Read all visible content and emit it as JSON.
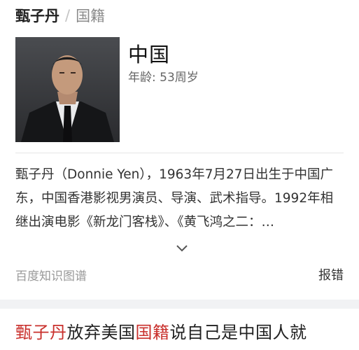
{
  "breadcrumb": {
    "main": "甄子丹",
    "separator": "/",
    "sub": "国籍"
  },
  "answer": {
    "value": "中国",
    "age_label": "年龄:",
    "age_value": "53周岁"
  },
  "summary": {
    "text": "甄子丹（Donnie Yen），1963年7月27日出生于中国广东，中国香港影视男演员、导演、武术指导。1992年相继出演电影《新龙门客栈》、《黄飞鸿之二：…"
  },
  "footer": {
    "source": "百度知识图谱",
    "report": "报错"
  },
  "headline": {
    "part1": "甄子丹",
    "part2": "放弃美国",
    "part3": "国籍",
    "part4": "说自己是中国人就"
  },
  "colors": {
    "highlight": "#c9302c",
    "band": "#f1f2f4"
  },
  "icons": {
    "expand": "chevron-down-icon"
  }
}
